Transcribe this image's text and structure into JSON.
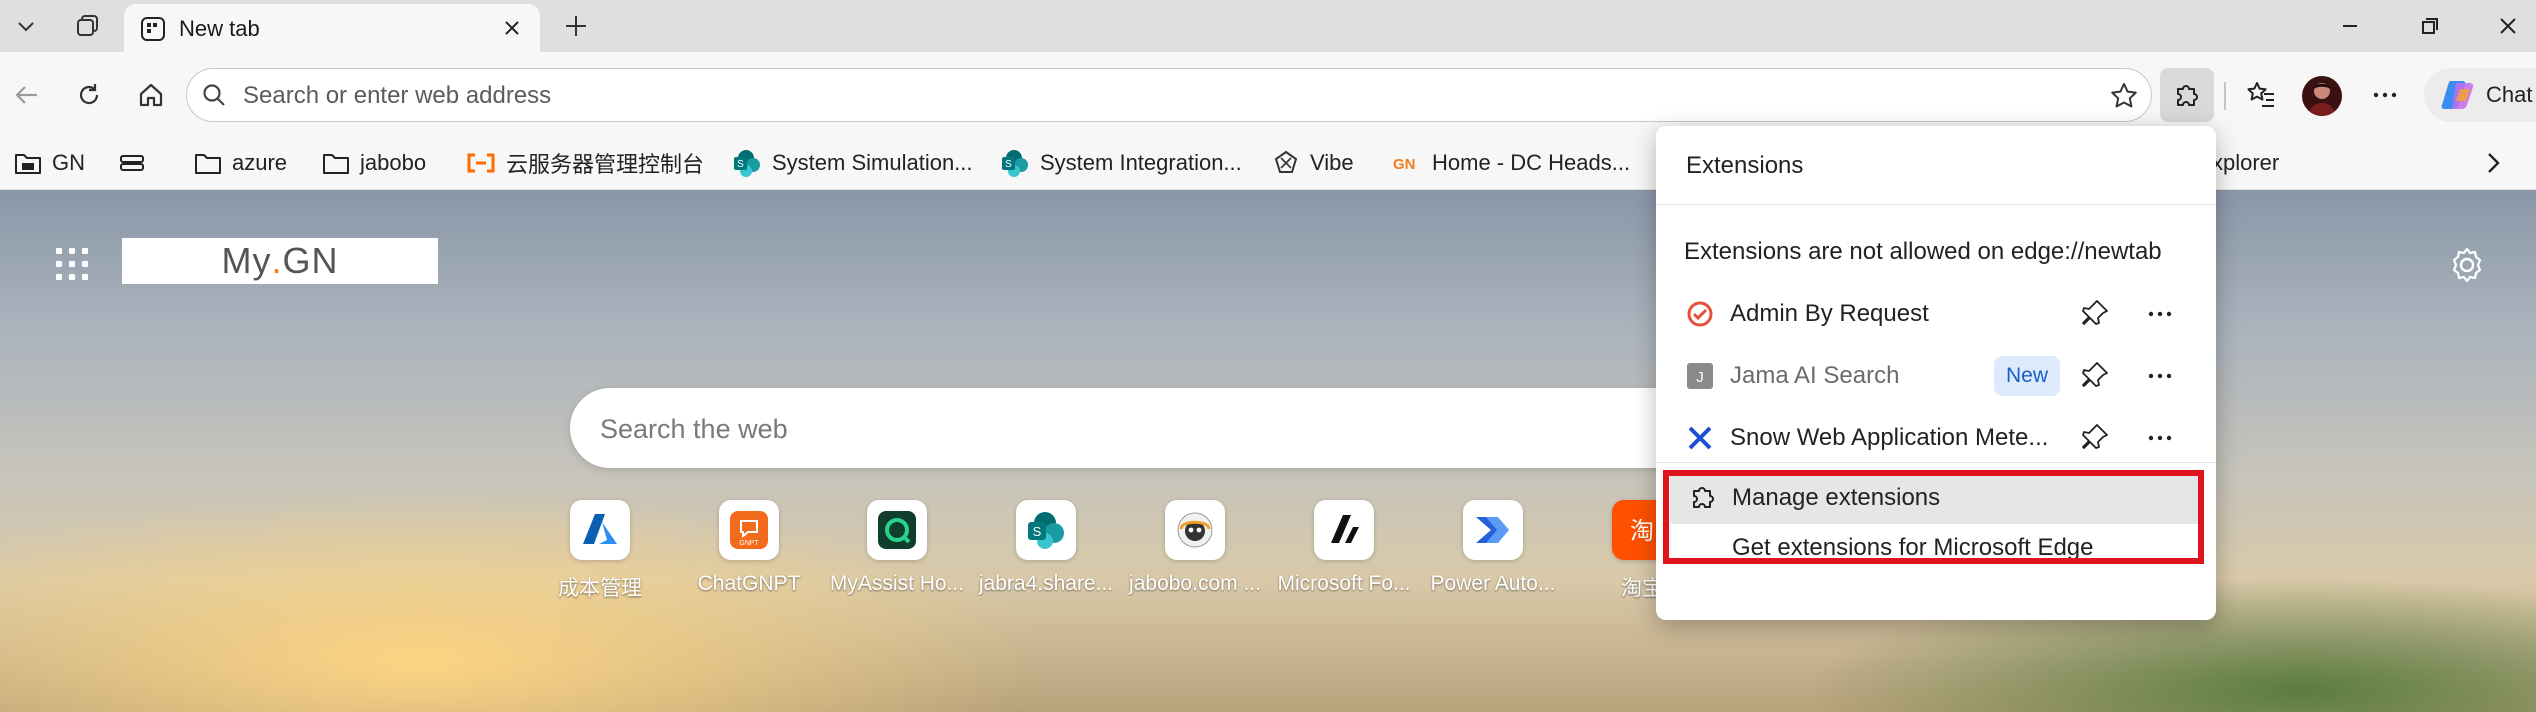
{
  "browser": {
    "tab": {
      "title": "New tab"
    },
    "address_bar": {
      "placeholder": "Search or enter web address"
    },
    "copilot_label": "Chat"
  },
  "favorites": [
    {
      "label": "GN",
      "icon": "folder-icon"
    },
    {
      "label": "",
      "icon": "stack-icon"
    },
    {
      "label": "azure",
      "icon": "folder-icon"
    },
    {
      "label": "jabobo",
      "icon": "folder-icon"
    },
    {
      "label": "云服务器管理控制台",
      "icon": "aliyun-icon"
    },
    {
      "label": "System Simulation...",
      "icon": "sharepoint-icon"
    },
    {
      "label": "System Integration...",
      "icon": "sharepoint-icon"
    },
    {
      "label": "Vibe",
      "icon": "vibe-icon"
    },
    {
      "label": "Home - DC Heads...",
      "icon": "gn-icon"
    },
    {
      "label": "xplorer",
      "icon": ""
    }
  ],
  "newtab": {
    "brand": {
      "prefix": "My",
      "dot": ".",
      "suffix": "GN"
    },
    "search_placeholder": "Search the web",
    "tiles": [
      {
        "label": "成本管理",
        "icon": "azure-icon"
      },
      {
        "label": "ChatGNPT",
        "icon": "chatgnpt-icon"
      },
      {
        "label": "MyAssist Ho...",
        "icon": "myassist-icon"
      },
      {
        "label": "jabra4.share...",
        "icon": "sharepoint-icon"
      },
      {
        "label": "jabobo.com ...",
        "icon": "jabobo-icon"
      },
      {
        "label": "Microsoft Fo...",
        "icon": "forms-icon"
      },
      {
        "label": "Power Auto...",
        "icon": "power-automate-icon"
      },
      {
        "label": "淘宝",
        "icon": "taobao-icon"
      }
    ]
  },
  "extensions_panel": {
    "title": "Extensions",
    "notice": "Extensions are not allowed on edge://newtab",
    "items": [
      {
        "name": "Admin By Request",
        "icon": "admin-by-request-icon",
        "badge": ""
      },
      {
        "name": "Jama AI Search",
        "icon": "jama-icon",
        "badge": "New"
      },
      {
        "name": "Snow Web Application Mete...",
        "icon": "snow-icon",
        "badge": ""
      }
    ],
    "manage_label": "Manage extensions",
    "get_label": "Get extensions for Microsoft Edge"
  },
  "colors": {
    "highlight": "#e0141d",
    "brand_dot": "#f07d1a",
    "badge_bg": "#ddeafc"
  }
}
